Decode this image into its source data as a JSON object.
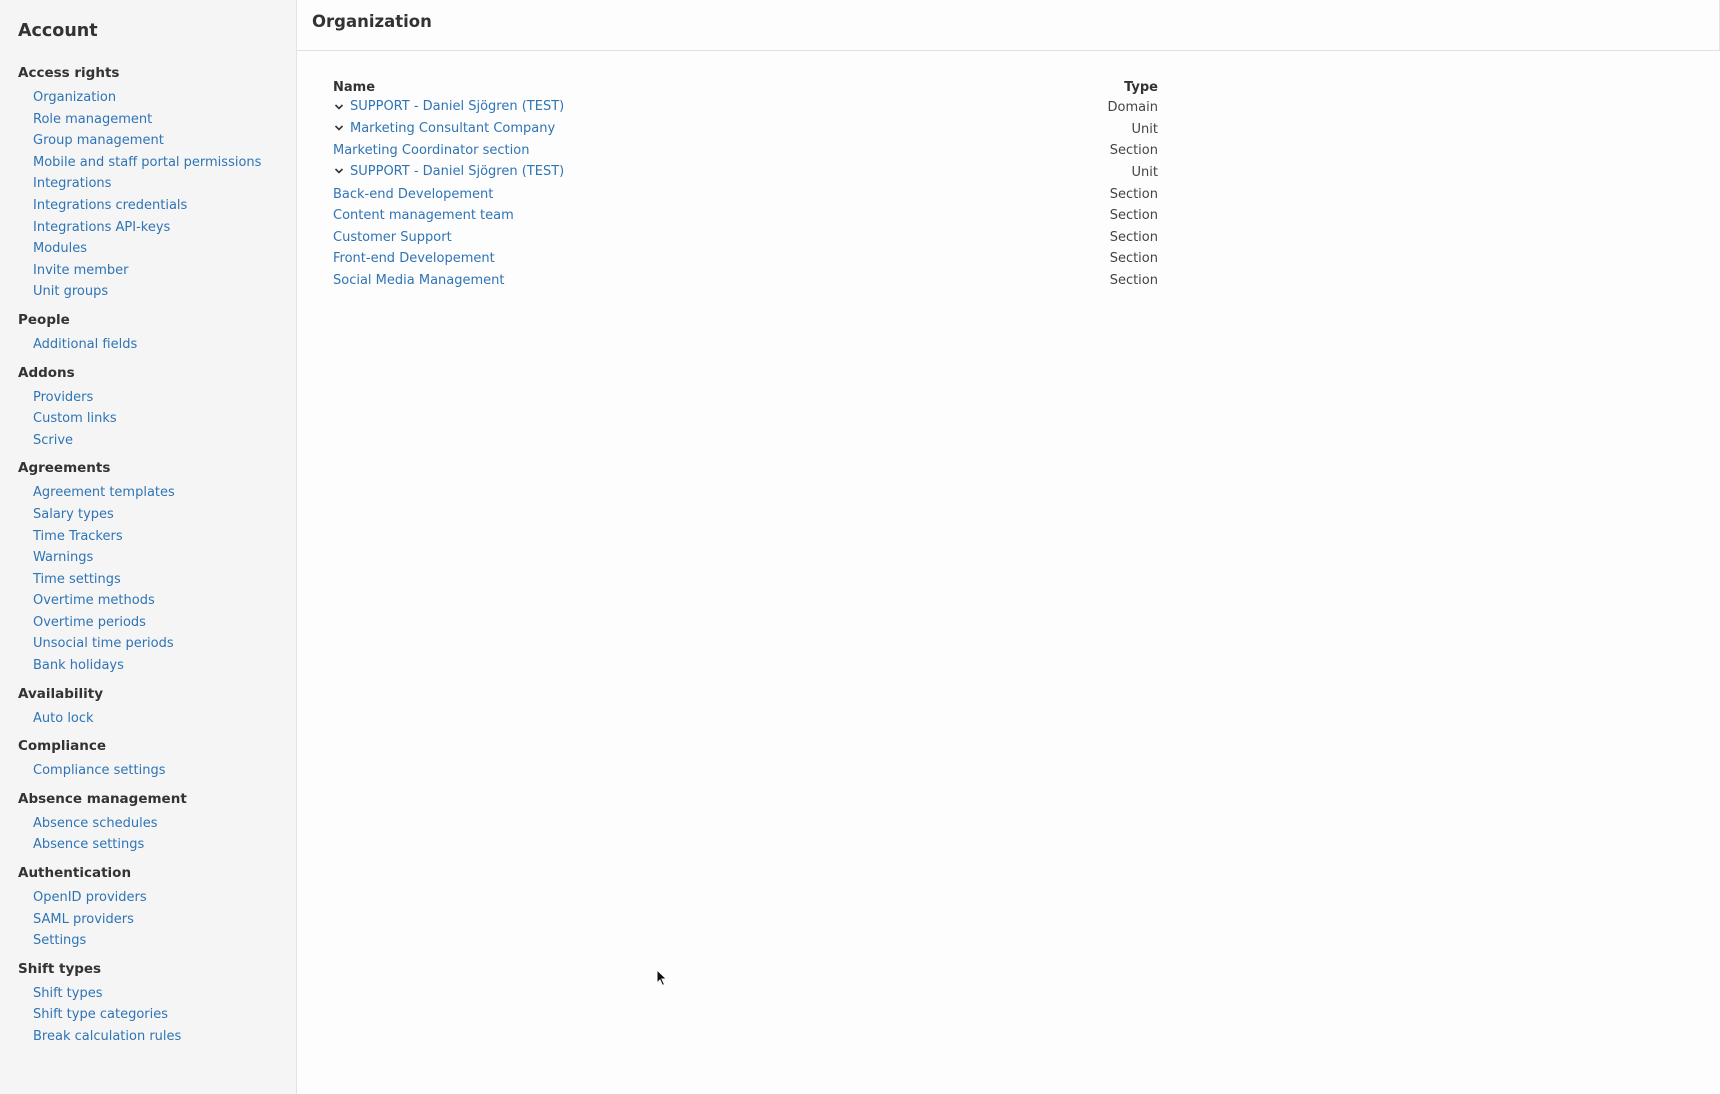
{
  "sidebar": {
    "title": "Account",
    "sections": [
      {
        "heading": "Access rights",
        "items": [
          "Organization",
          "Role management",
          "Group management",
          "Mobile and staff portal permissions",
          "Integrations",
          "Integrations credentials",
          "Integrations API-keys",
          "Modules",
          "Invite member",
          "Unit groups"
        ]
      },
      {
        "heading": "People",
        "items": [
          "Additional fields"
        ]
      },
      {
        "heading": "Addons",
        "items": [
          "Providers",
          "Custom links",
          "Scrive"
        ]
      },
      {
        "heading": "Agreements",
        "items": [
          "Agreement templates",
          "Salary types",
          "Time Trackers",
          "Warnings",
          "Time settings",
          "Overtime methods",
          "Overtime periods",
          "Unsocial time periods",
          "Bank holidays"
        ]
      },
      {
        "heading": "Availability",
        "items": [
          "Auto lock"
        ]
      },
      {
        "heading": "Compliance",
        "items": [
          "Compliance settings"
        ]
      },
      {
        "heading": "Absence management",
        "items": [
          "Absence schedules",
          "Absence settings"
        ]
      },
      {
        "heading": "Authentication",
        "items": [
          "OpenID providers",
          "SAML providers",
          "Settings"
        ]
      },
      {
        "heading": "Shift types",
        "items": [
          "Shift types",
          "Shift type categories",
          "Break calculation rules"
        ]
      }
    ]
  },
  "main": {
    "title": "Organization",
    "table": {
      "headers": {
        "name": "Name",
        "type": "Type"
      },
      "rows": [
        {
          "name": "SUPPORT - Daniel Sjögren (TEST)",
          "type": "Domain",
          "level": 0,
          "expandable": true
        },
        {
          "name": "Marketing Consultant Company",
          "type": "Unit",
          "level": 1,
          "expandable": true
        },
        {
          "name": "Marketing Coordinator section",
          "type": "Section",
          "level": 2,
          "expandable": false
        },
        {
          "name": "SUPPORT - Daniel Sjögren (TEST)",
          "type": "Unit",
          "level": 1,
          "expandable": true
        },
        {
          "name": "Back-end Developement",
          "type": "Section",
          "level": 2,
          "expandable": false
        },
        {
          "name": "Content management team",
          "type": "Section",
          "level": 2,
          "expandable": false
        },
        {
          "name": "Customer Support",
          "type": "Section",
          "level": 2,
          "expandable": false
        },
        {
          "name": "Front-end Developement",
          "type": "Section",
          "level": 2,
          "expandable": false
        },
        {
          "name": "Social Media Management",
          "type": "Section",
          "level": 2,
          "expandable": false
        }
      ]
    }
  },
  "icons": {
    "expand": "chevron-down-icon",
    "cursor": "mouse-pointer-icon"
  },
  "colors": {
    "link": "#2f74b5",
    "sidebar_bg": "#f5f5f5",
    "text": "#333333"
  }
}
